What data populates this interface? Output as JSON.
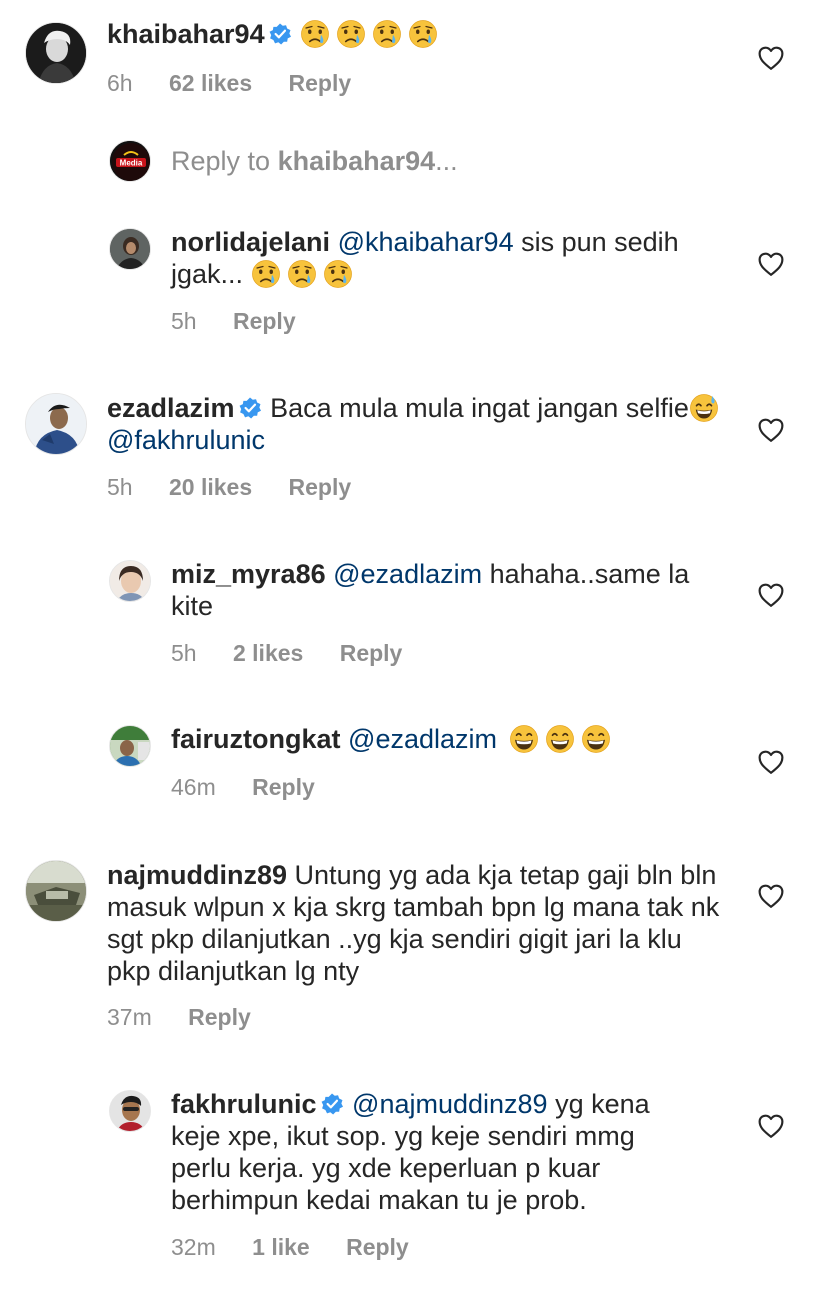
{
  "comments": [
    {
      "username": "khaibahar94",
      "verified": true,
      "text": "",
      "emojis": [
        "crying-face",
        "crying-face",
        "crying-face",
        "crying-face"
      ],
      "time": "6h",
      "likes": "62 likes",
      "reply": "Reply"
    },
    {
      "reply_prompt": {
        "prefix": "Reply to ",
        "username": "khaibahar94",
        "suffix": "..."
      }
    },
    {
      "username": "norlidajelani",
      "mention": "@khaibahar94",
      "text": " sis pun sedih jgak...",
      "emojis": [
        "crying-face",
        "crying-face",
        "crying-face"
      ],
      "time": "5h",
      "reply": "Reply"
    },
    {
      "username": "ezadlazim",
      "verified": true,
      "text": "Baca mula mula ingat jangan selfie",
      "emoji_inline": "sweat-smile-face",
      "mention": "@fakhrulunic",
      "time": "5h",
      "likes": "20 likes",
      "reply": "Reply"
    },
    {
      "username": "miz_myra86",
      "mention": "@ezadlazim",
      "text": " hahaha..same la kite",
      "time": "5h",
      "likes": "2 likes",
      "reply": "Reply"
    },
    {
      "username": "fairuztongkat",
      "mention": "@ezadlazim",
      "emojis": [
        "grinning-face",
        "grinning-face",
        "grinning-face"
      ],
      "time": "46m",
      "reply": "Reply"
    },
    {
      "username": "najmuddinz89",
      "text": "Untung yg ada kja tetap gaji bln bln masuk wlpun x kja skrg tambah bpn lg mana tak nk sgt pkp dilanjutkan ..yg kja sendiri gigit jari la klu pkp dilanjutkan lg nty",
      "time": "37m",
      "reply": "Reply"
    },
    {
      "username": "fakhrulunic",
      "verified": true,
      "mention": "@najmuddinz89",
      "text": " yg kena keje xpe, ikut sop. yg keje sendiri mmg perlu kerja. yg xde keperluan p kuar berhimpun kedai makan tu je prob.",
      "time": "32m",
      "likes": "1 like",
      "reply": "Reply"
    }
  ],
  "colors": {
    "text": "#262626",
    "muted": "#8e8e8e",
    "mention": "#00376b",
    "verified": "#3897f0"
  }
}
